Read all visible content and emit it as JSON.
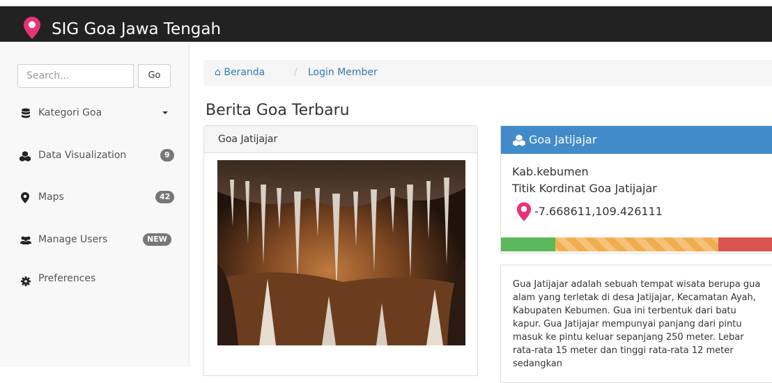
{
  "app": {
    "title": "SIG Goa Jawa Tengah",
    "accent": "#e8337a"
  },
  "sidebar": {
    "search_placeholder": "Search...",
    "go_label": "Go",
    "items": [
      {
        "label": "Kategori Goa",
        "icon": "database-icon"
      },
      {
        "label": "Data Visualization",
        "icon": "cubes-icon",
        "badge": "9"
      },
      {
        "label": "Maps",
        "icon": "map-marker-icon",
        "badge": "42"
      },
      {
        "label": "Manage Users",
        "icon": "users-icon",
        "badge": "NEW"
      },
      {
        "label": "Preferences",
        "icon": "gear-icon"
      }
    ]
  },
  "breadcrumb": {
    "home": "Beranda",
    "separator": "/",
    "current": "Login Member"
  },
  "main": {
    "page_title": "Berita Goa Terbaru",
    "news_panel": {
      "heading": "Goa Jatijajar",
      "image": "cave-photo"
    },
    "info_panel": {
      "heading": "Goa Jatijajar",
      "heading_color": "#428bca",
      "location": "Kab.kebumen",
      "coord_label": "Titik Kordinat Goa Jatijajar",
      "coordinates": "-7.668611,109.426111",
      "progress": [
        {
          "color": "#5cb85c",
          "percent": 20
        },
        {
          "color": "#f0ad4e",
          "percent": 60
        },
        {
          "color": "#d9534f",
          "percent": 20
        }
      ]
    },
    "description": "Gua Jatijajar adalah sebuah tempat wisata berupa gua alam yang terletak di desa Jatijajar, Kecamatan Ayah, Kabupaten Kebumen. Gua ini terbentuk dari batu kapur. Gua Jatijajar mempunyai panjang dari pintu masuk ke pintu keluar sepanjang 250 meter. Lebar rata-rata 15 meter dan tinggi rata-rata 12 meter sedangkan"
  }
}
